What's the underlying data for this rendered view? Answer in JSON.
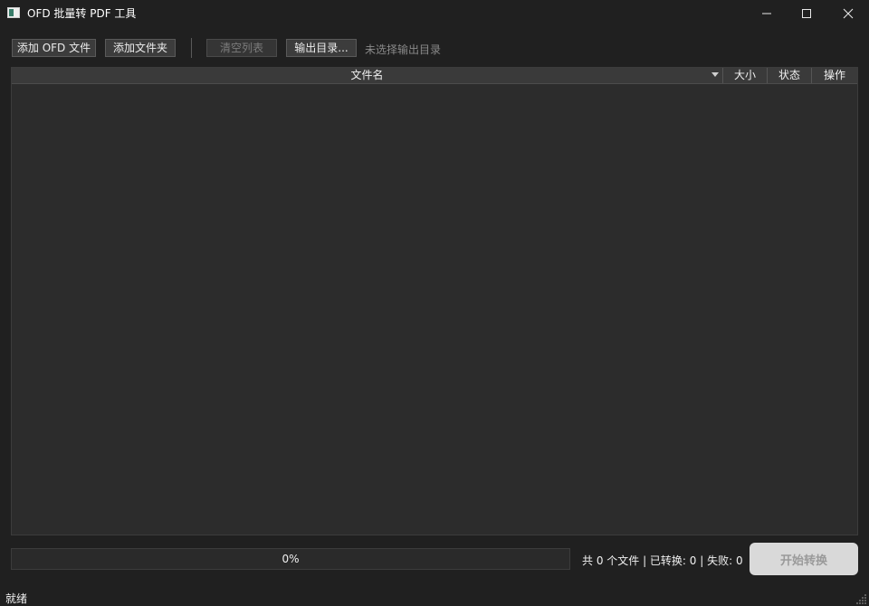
{
  "window": {
    "title": "OFD 批量转 PDF 工具"
  },
  "toolbar": {
    "add_ofd_label": "添加 OFD 文件",
    "add_folder_label": "添加文件夹",
    "clear_list_label": "清空列表",
    "output_dir_label": "输出目录...",
    "output_dir_status": "未选择输出目录"
  },
  "table": {
    "columns": [
      "文件名",
      "大小",
      "状态",
      "操作"
    ],
    "rows": []
  },
  "progress": {
    "percent": 0,
    "label": "0%"
  },
  "summary": {
    "text": "共 0 个文件 | 已转换: 0 | 失败: 0"
  },
  "actions": {
    "start_label": "开始转换"
  },
  "statusbar": {
    "text": "就绪"
  },
  "icons": {
    "app": "app-icon",
    "minimize": "minimize-icon",
    "maximize": "maximize-icon",
    "close": "close-icon",
    "sort": "sort-down-icon",
    "grip": "size-grip-icon"
  },
  "colors": {
    "background": "#202020",
    "table_background": "#2c2c2c",
    "header_background": "#3a3a3a",
    "progress_fill": "#2d6cb3"
  }
}
